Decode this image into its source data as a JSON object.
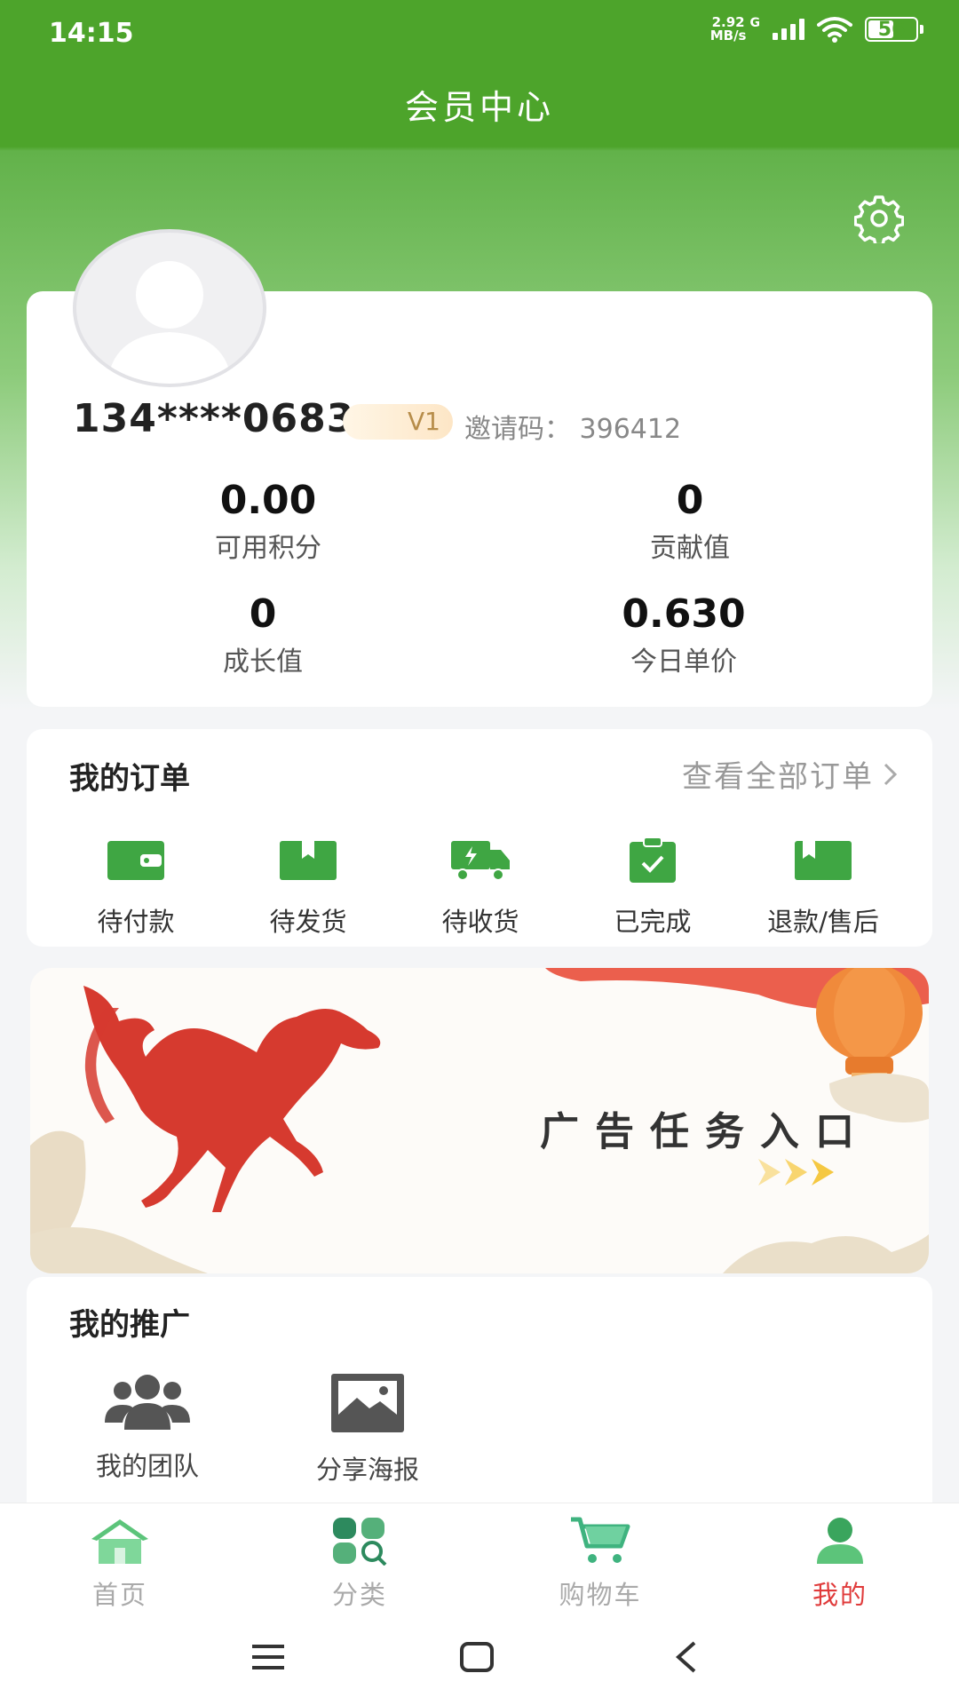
{
  "status_bar": {
    "time": "14:15",
    "net_speed_top": "2.92",
    "net_speed_bottom": "MB/s",
    "network_type": "G",
    "battery": "56"
  },
  "header": {
    "title": "会员中心"
  },
  "profile": {
    "username": "134****0683",
    "level": "V1",
    "invite_code_text": "邀请码：  396412",
    "stats": [
      {
        "value": "0.00",
        "label": "可用积分"
      },
      {
        "value": "0",
        "label": "贡献值"
      },
      {
        "value": "0",
        "label": "成长值"
      },
      {
        "value": "0.630",
        "label": "今日单价"
      }
    ]
  },
  "orders": {
    "title": "我的订单",
    "view_all": "查看全部订单",
    "items": [
      {
        "label": "待付款",
        "icon": "wallet-icon"
      },
      {
        "label": "待发货",
        "icon": "box-icon"
      },
      {
        "label": "待收货",
        "icon": "truck-icon"
      },
      {
        "label": "已完成",
        "icon": "clipboard-check-icon"
      },
      {
        "label": "退款/售后",
        "icon": "box-icon"
      }
    ],
    "accent": "#3fa643"
  },
  "banner": {
    "text": "广告任务入口"
  },
  "promotion": {
    "title": "我的推广",
    "items": [
      {
        "label": "我的团队",
        "icon": "team-icon"
      },
      {
        "label": "分享海报",
        "icon": "image-icon"
      }
    ]
  },
  "tabbar": {
    "items": [
      {
        "label": "首页",
        "icon": "home-icon"
      },
      {
        "label": "分类",
        "icon": "category-icon"
      },
      {
        "label": "购物车",
        "icon": "cart-icon"
      },
      {
        "label": "我的",
        "icon": "user-icon"
      }
    ],
    "active_index": 3,
    "active_color": "#e03b3b"
  },
  "colors": {
    "header_green": "#4da42b"
  }
}
